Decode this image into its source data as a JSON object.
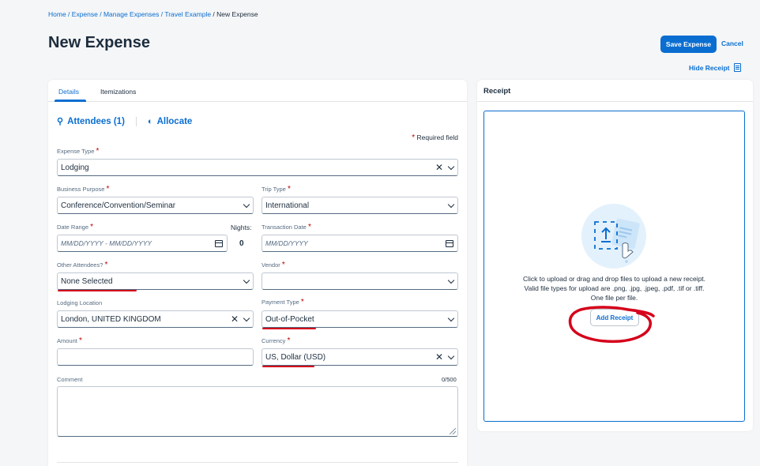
{
  "breadcrumb": {
    "home": "Home",
    "expense": "Expense",
    "manage": "Manage Expenses",
    "travel": "Travel Example",
    "current": "New Expense",
    "sep": " / "
  },
  "page_title": "New Expense",
  "actions": {
    "save": "Save Expense",
    "cancel": "Cancel",
    "hide_receipt": "Hide Receipt"
  },
  "tabs": [
    {
      "label": "Details",
      "active": true
    },
    {
      "label": "Itemizations",
      "active": false
    }
  ],
  "links": {
    "attendees": "Attendees (1)",
    "allocate": "Allocate"
  },
  "required_note": "Required field",
  "required_mark": "*",
  "fields": {
    "expense_type": {
      "label": "Expense Type",
      "value": "Lodging",
      "required": true
    },
    "business_purpose": {
      "label": "Business Purpose",
      "value": "Conference/Convention/Seminar",
      "required": true
    },
    "trip_type": {
      "label": "Trip Type",
      "value": "International",
      "required": true
    },
    "date_range": {
      "label": "Date Range",
      "placeholder": "MM/DD/YYYY - MM/DD/YYYY",
      "required": true
    },
    "nights": {
      "label": "Nights:",
      "value": "0"
    },
    "transaction_date": {
      "label": "Transaction Date",
      "placeholder": "MM/DD/YYYY",
      "required": true
    },
    "other_attendees": {
      "label": "Other Attendees?",
      "value": "None Selected",
      "required": true
    },
    "vendor": {
      "label": "Vendor",
      "value": "",
      "required": true
    },
    "lodging_location": {
      "label": "Lodging Location",
      "value": "London, UNITED KINGDOM"
    },
    "payment_type": {
      "label": "Payment Type",
      "value": "Out-of-Pocket",
      "required": true
    },
    "amount": {
      "label": "Amount",
      "value": "",
      "required": true
    },
    "currency": {
      "label": "Currency",
      "value": "US, Dollar (USD)",
      "required": true
    },
    "comment": {
      "label": "Comment",
      "counter": "0/500"
    }
  },
  "receipt": {
    "title": "Receipt",
    "line1": "Click to upload or drag and drop files to upload a new receipt.",
    "line2": "Valid file types for upload are .png, .jpg, .jpeg, .pdf, .tif or .tiff.",
    "line3": "One file per file.",
    "button": "Add Receipt"
  },
  "colors": {
    "accent": "#0a6ed1",
    "required": "#bb0000",
    "annotation": "#d5001a"
  },
  "icons": [
    "attendees-icon",
    "allocate-icon",
    "receipt-icon",
    "calendar-icon",
    "clear-icon",
    "chevron-down-icon",
    "upload-icon"
  ]
}
